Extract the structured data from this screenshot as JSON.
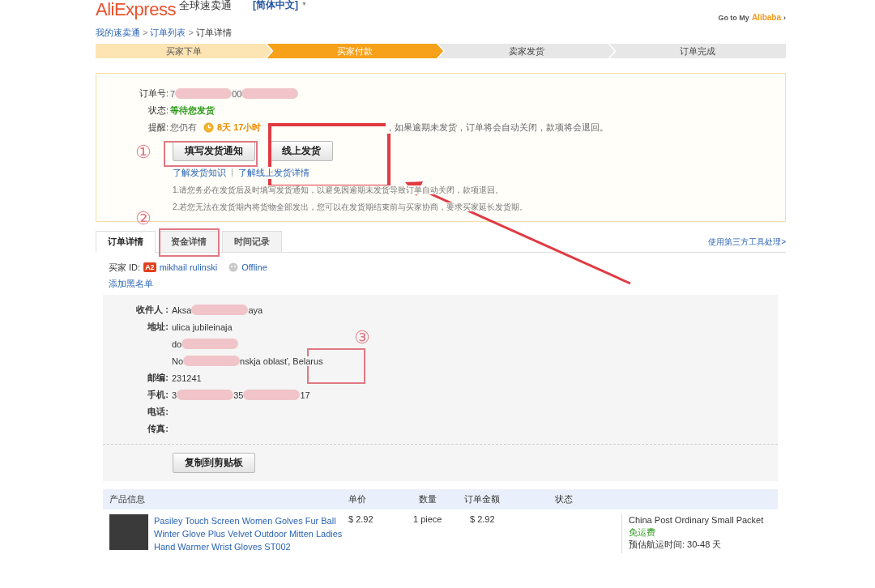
{
  "header": {
    "logo": "AliExpress",
    "logo_sub": "全球速卖通",
    "language": "[简体中文]",
    "language_caret": "▼",
    "alibaba_prefix": "Go to My",
    "alibaba_brand": "Alibaba",
    "alibaba_caret": "›"
  },
  "breadcrumb": [
    {
      "text": "我的速卖通",
      "kind": "link"
    },
    {
      "text": "订单列表",
      "kind": "link"
    },
    {
      "text": "订单详情",
      "kind": "current"
    }
  ],
  "breadcrumb_separator": ">",
  "steps": [
    {
      "label": "买家下单",
      "completed": true,
      "selected": false
    },
    {
      "label": "买家付款",
      "selected": true
    },
    {
      "label": "卖家发货",
      "completed": false,
      "selected": false
    },
    {
      "label": "订单完成",
      "completed": false,
      "selected": false
    }
  ],
  "order": {
    "rows": [
      {
        "label": "订单号:",
        "kind": "segments",
        "segments": [
          {
            "kind": "text",
            "text": "7"
          },
          {
            "kind": "redacted"
          },
          {
            "kind": "text",
            "text": "00"
          },
          {
            "kind": "redacted"
          }
        ]
      },
      {
        "label": "状态:",
        "kind": "status",
        "text": "等待您发货"
      },
      {
        "label": "提醒:",
        "kind": "reminder",
        "prefix": "您仍有",
        "countdown": "8天 17小时",
        "suffix": "，如果逾期未发货，订单将会自动关闭，款项将会退回。"
      }
    ],
    "buttons": [
      "填写发货通知",
      "线上发货"
    ],
    "links": [
      "了解发货知识",
      "了解线上发货详情"
    ],
    "links_separator": "|",
    "notes": [
      "1.请您务必在发货后及时填写发货通知，以避免因逾期未发货导致订单自动关闭，款项退回。",
      "2.若您无法在发货期内将货物全部发出，您可以在发货期结束前与买家协商，要求买家延长发货期。"
    ]
  },
  "tabs": [
    {
      "label": "订单详情",
      "selected": true
    },
    {
      "label": "资金详情",
      "selected": false
    },
    {
      "label": "时间记录",
      "selected": false
    }
  ],
  "third_party_link": "使用第三方工具处理>",
  "buyer": {
    "label": "买家 ID:",
    "badge": "A2",
    "name": "mikhail rulinski",
    "online": false,
    "status_text": "Offline",
    "blacklist_link": "添加黑名单"
  },
  "address": {
    "rows": [
      {
        "label": "收件人 :",
        "lines": [
          [
            {
              "kind": "text",
              "text": "Aksa"
            },
            {
              "kind": "redacted"
            },
            {
              "kind": "text",
              "text": "aya"
            }
          ]
        ]
      },
      {
        "label": "地址:",
        "lines": [
          [
            {
              "kind": "text",
              "text": "ulica jubileinaja"
            }
          ],
          [
            {
              "kind": "text",
              "text": "do"
            },
            {
              "kind": "redacted"
            }
          ],
          [
            {
              "kind": "text",
              "text": "No"
            },
            {
              "kind": "redacted"
            },
            {
              "kind": "text",
              "text": "nskja oblasť, Belarus"
            }
          ]
        ]
      },
      {
        "label": "邮编:",
        "lines": [
          [
            {
              "kind": "text",
              "text": "231241"
            }
          ]
        ]
      },
      {
        "label": "手机:",
        "lines": [
          [
            {
              "kind": "text",
              "text": "3"
            },
            {
              "kind": "redacted"
            },
            {
              "kind": "text",
              "text": "35"
            },
            {
              "kind": "redacted"
            },
            {
              "kind": "text",
              "text": "17"
            }
          ]
        ]
      },
      {
        "label": "电话:",
        "lines": []
      },
      {
        "label": "传真:",
        "lines": []
      }
    ],
    "copy_button": "复制到剪贴板"
  },
  "table": {
    "columns": [
      "产品信息",
      "单价",
      "数量",
      "订单金额",
      "状态"
    ],
    "rows": [
      {
        "title": "Pasiley Touch Screen Women Golves Fur Ball Winter Glove Plus Velvet Outdoor Mitten Ladies Hand Warmer Wrist Gloves ST002",
        "price": "$ 2.92",
        "quantity": "1 piece",
        "amount": "$ 2.92",
        "shipping": "China Post Ordinary Small Packet",
        "shipping_fee": "免运费",
        "delivery_time": "预估航运时间: 30-48 天"
      }
    ]
  },
  "annotations": [
    {
      "label": "①"
    },
    {
      "label": "②"
    },
    {
      "label": "③"
    }
  ]
}
